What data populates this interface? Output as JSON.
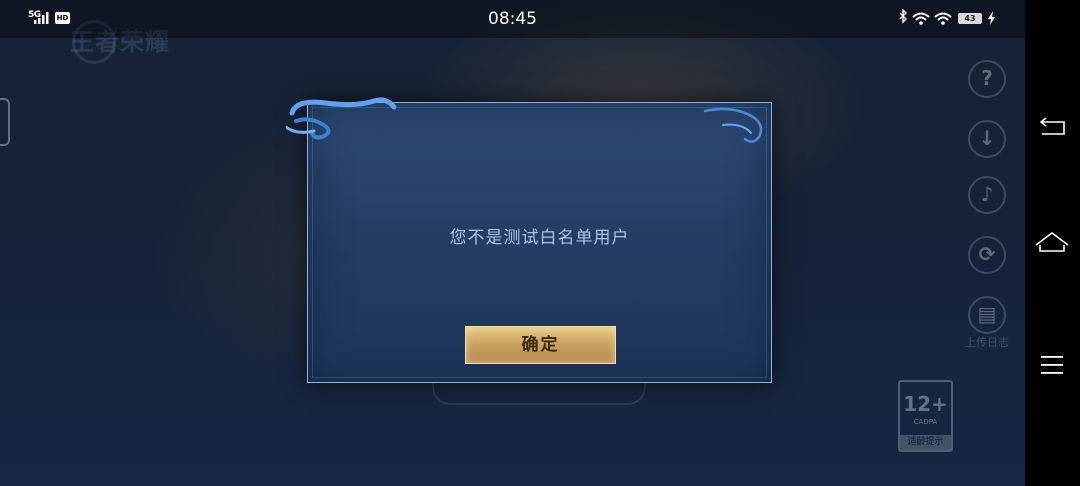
{
  "status_bar": {
    "network": "5G",
    "hd_badge": "HD",
    "time": "08:45",
    "battery": "43"
  },
  "game": {
    "logo_text": "王者荣耀",
    "right_tools": [
      {
        "icon": "help-icon",
        "glyph": "?",
        "label": ""
      },
      {
        "icon": "download-icon",
        "glyph": "↓",
        "label": ""
      },
      {
        "icon": "speaker-icon",
        "glyph": "♪",
        "label": ""
      },
      {
        "icon": "repair-icon",
        "glyph": "⟳",
        "label": ""
      },
      {
        "icon": "clipboard-icon",
        "glyph": "▤",
        "label": "上传日志"
      }
    ],
    "age_rating": {
      "number": "12+",
      "org": "CADPA",
      "tip": "适龄提示"
    }
  },
  "dialog": {
    "message": "您不是测试白名单用户",
    "confirm_label": "确定"
  },
  "colors": {
    "dialog_bg": "#2c4a74",
    "message_text": "#a8c4e6",
    "confirm_gold": "#c9a15e"
  }
}
